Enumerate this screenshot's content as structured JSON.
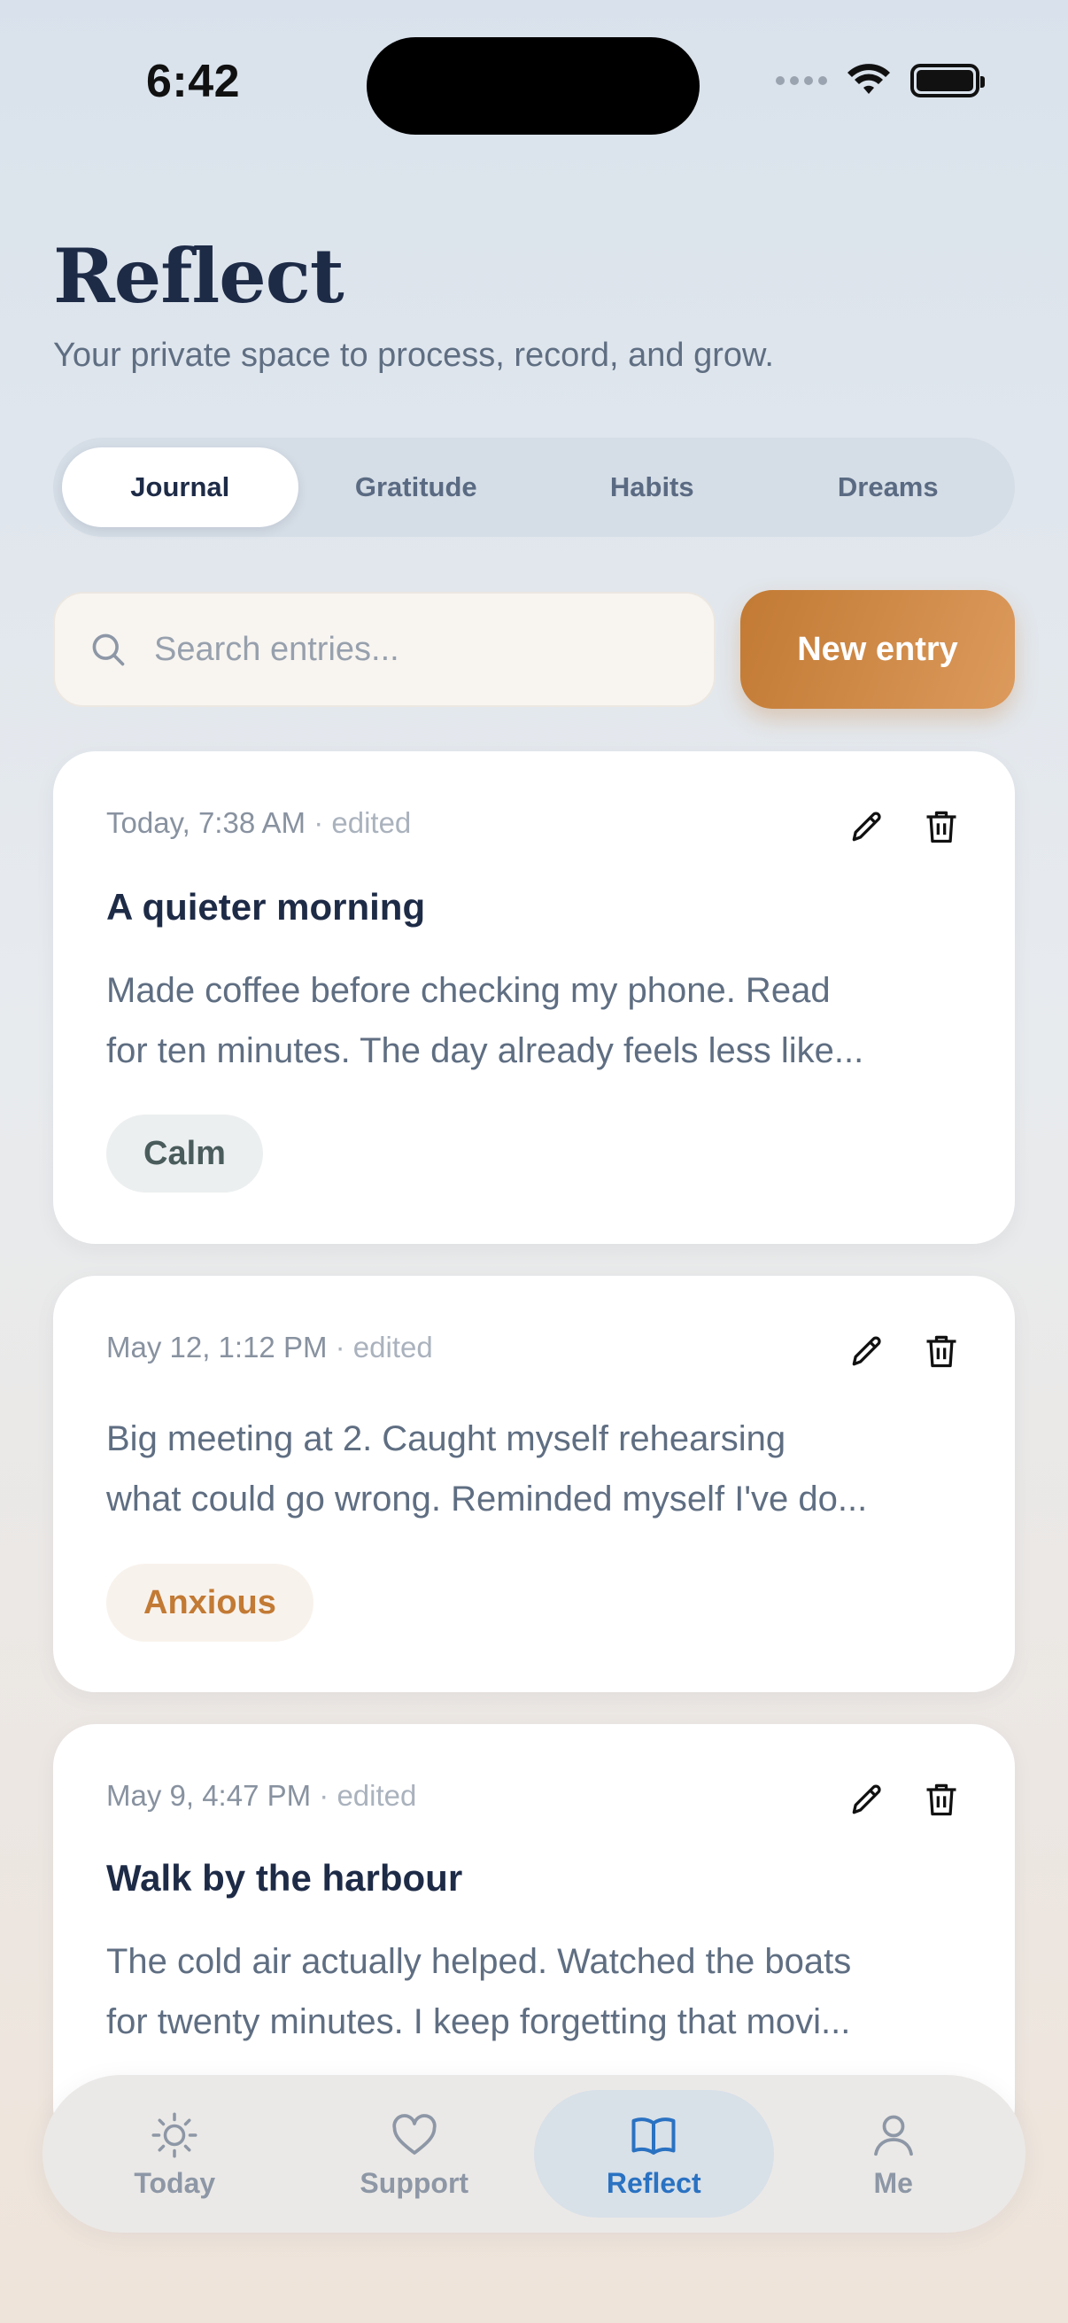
{
  "status_bar": {
    "time": "6:42"
  },
  "header": {
    "title": "Reflect",
    "subtitle": "Your private space to process, record, and grow."
  },
  "tabs": [
    {
      "label": "Journal",
      "active": true
    },
    {
      "label": "Gratitude",
      "active": false
    },
    {
      "label": "Habits",
      "active": false
    },
    {
      "label": "Dreams",
      "active": false
    }
  ],
  "search": {
    "placeholder": "Search entries...",
    "value": ""
  },
  "new_entry_label": "New entry",
  "entries": [
    {
      "timestamp": "Today, 7:38 AM",
      "edited": "· edited",
      "title": "A quieter morning",
      "body_lines": [
        "Made coffee before checking my phone. Read",
        "for ten minutes. The day already feels less like..."
      ],
      "mood": "Calm"
    },
    {
      "timestamp": "May 12, 1:12 PM",
      "edited": "· edited",
      "title": "",
      "body_lines": [
        "Big meeting at 2. Caught myself rehearsing",
        "what could go wrong. Reminded myself I've do..."
      ],
      "mood": "Anxious"
    },
    {
      "timestamp": "May 9, 4:47 PM",
      "edited": "· edited",
      "title": "Walk by the harbour",
      "body_lines": [
        "The cold air actually helped. Watched the boats",
        "for twenty minutes. I keep forgetting that movi..."
      ],
      "mood": ""
    }
  ],
  "nav": [
    {
      "label": "Today",
      "icon": "sun-icon",
      "active": false
    },
    {
      "label": "Support",
      "icon": "heart-icon",
      "active": false
    },
    {
      "label": "Reflect",
      "icon": "book-icon",
      "active": true
    },
    {
      "label": "Me",
      "icon": "person-icon",
      "active": false
    }
  ],
  "colors": {
    "accent": "#c27a34",
    "nav_active": "#2a72c2",
    "title": "#1e2b47"
  }
}
